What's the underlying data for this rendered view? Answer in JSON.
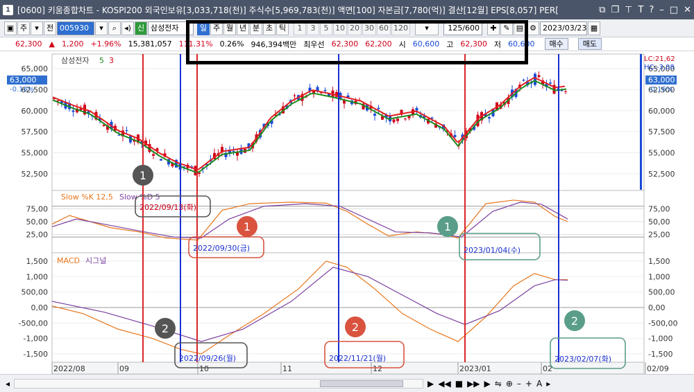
{
  "window": {
    "number": "1",
    "title": "[0600] 키움종합차트 - KOSPI200 외국인보유[3,033,718(천)] 주식수[5,969,783(천)] 액면[100] 자본금[7,780(억)] 결산[12월] EPS[8,057] PER["
  },
  "toolbar": {
    "period_select": "주",
    "prev_label": "전",
    "stock_code": "005930",
    "stock_badge": "신",
    "stock_name": "삼성전자",
    "tabs": [
      "일",
      "주",
      "월",
      "년",
      "분",
      "초",
      "틱"
    ],
    "active_tab": "일",
    "intervals": [
      "1",
      "3",
      "5",
      "10",
      "20",
      "30",
      "60",
      "120"
    ],
    "count": "125/600",
    "date": "2023/03/23"
  },
  "quote": {
    "price": "62,300",
    "change_arrow": "▲",
    "change": "1,200",
    "change_pct": "+1.96%",
    "volume": "15,381,057",
    "volume_ratio": "111.31%",
    "turnover": "0.26%",
    "amount": "946,394백만",
    "best_label": "최우선",
    "best_ask": "62,300",
    "best_bid": "62,200",
    "open_label": "시",
    "open": "60,600",
    "high_label": "고",
    "high": "62,300",
    "low_label": "저",
    "low": "60,600",
    "buy": "매수",
    "sell": "매도"
  },
  "price_panel": {
    "name": "삼성전자",
    "ma_a": "5",
    "ma_b": "3",
    "ticks": [
      "65,000",
      "62,500",
      "60,000",
      "57,500",
      "55,000",
      "52,500"
    ],
    "current": "63,000",
    "current_pct": "-0.16%",
    "lc": "LC:21,62",
    "hc": "HC:-3,08"
  },
  "stoch_panel": {
    "label_k": "Slow %K 12,5",
    "label_d": "Slow %D 5",
    "ticks": [
      "75,00",
      "50,00",
      "25,00"
    ]
  },
  "macd_panel": {
    "label_macd": "MACD",
    "label_signal": "시그널",
    "ticks": [
      "1,500",
      "1,000",
      "500,00",
      "0,00",
      "-500,00",
      "-1,000",
      "-1,500"
    ]
  },
  "x_axis": {
    "labels": [
      "2022/08",
      "09",
      "10",
      "11",
      "12",
      "2023/01",
      "02",
      "02/09"
    ]
  },
  "annotations": {
    "circles": [
      "1",
      "1",
      "1",
      "2",
      "2",
      "2"
    ],
    "dates": [
      "2022/09/13(화)",
      "2022/09/30(금)",
      "2023/01/04(수)",
      "2022/09/26(월)",
      "2022/11/21(월)",
      "2023/02/07(화)"
    ]
  },
  "colors": {
    "up": "#d0021b",
    "down": "#1a4bd6",
    "ma_red": "#e02020",
    "ma_green": "#1e8a1e",
    "stoch_k": "#e8761b",
    "stoch_d": "#7b3fa0",
    "macd": "#e8761b",
    "signal": "#7b3fa0"
  },
  "chart_data": {
    "type": "line",
    "title": "삼성전자",
    "ylim": [
      51500,
      66000
    ],
    "x": [
      "2022/08",
      "2022/09",
      "2022/10",
      "2022/11",
      "2022/12",
      "2023/01",
      "2023/02",
      "2023/03"
    ],
    "series": [
      {
        "name": "삼성전자",
        "values": [
          61500,
          57000,
          54000,
          62000,
          58500,
          60200,
          63000,
          62300
        ]
      }
    ]
  }
}
